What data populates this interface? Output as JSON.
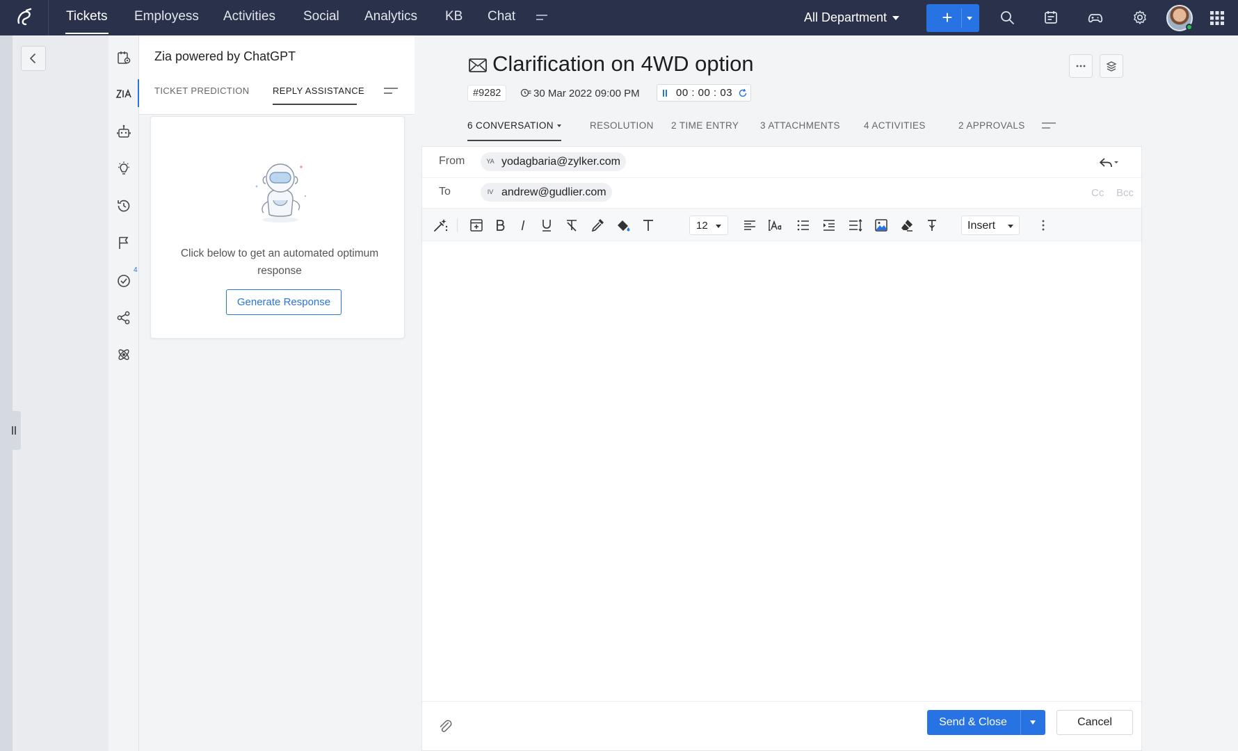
{
  "topnav": {
    "items": [
      "Tickets",
      "Employess",
      "Activities",
      "Social",
      "Analytics",
      "KB",
      "Chat"
    ],
    "department": "All Department"
  },
  "zia": {
    "title": "Zia powered by ChatGPT",
    "tabs": [
      "TICKET PREDICTION",
      "REPLY ASSISTANCE"
    ],
    "message": "Click below to get an automated optimum response",
    "generate_label": "Generate Response"
  },
  "rail": {
    "badge": "4"
  },
  "ticket": {
    "title": "Clarification on 4WD option",
    "id": "#9282",
    "due": "30 Mar 2022 09:00 PM",
    "timer": "00 : 00 : 03"
  },
  "tabs": [
    "6 CONVERSATION",
    "RESOLUTION",
    "2 TIME ENTRY",
    "3 ATTACHMENTS",
    "4 ACTIVITIES",
    "2 APPROVALS"
  ],
  "composer": {
    "from_label": "From",
    "from_initials": "YA",
    "from_email": "yodagbaria@zylker.com",
    "to_label": "To",
    "to_initials": "IV",
    "to_email": "andrew@gudlier.com",
    "cc": "Cc",
    "bcc": "Bcc",
    "font_size": "12",
    "insert_label": "Insert",
    "send_label": "Send & Close",
    "cancel_label": "Cancel"
  },
  "colors": {
    "topbar": "#29324a",
    "accent": "#2773e3"
  }
}
